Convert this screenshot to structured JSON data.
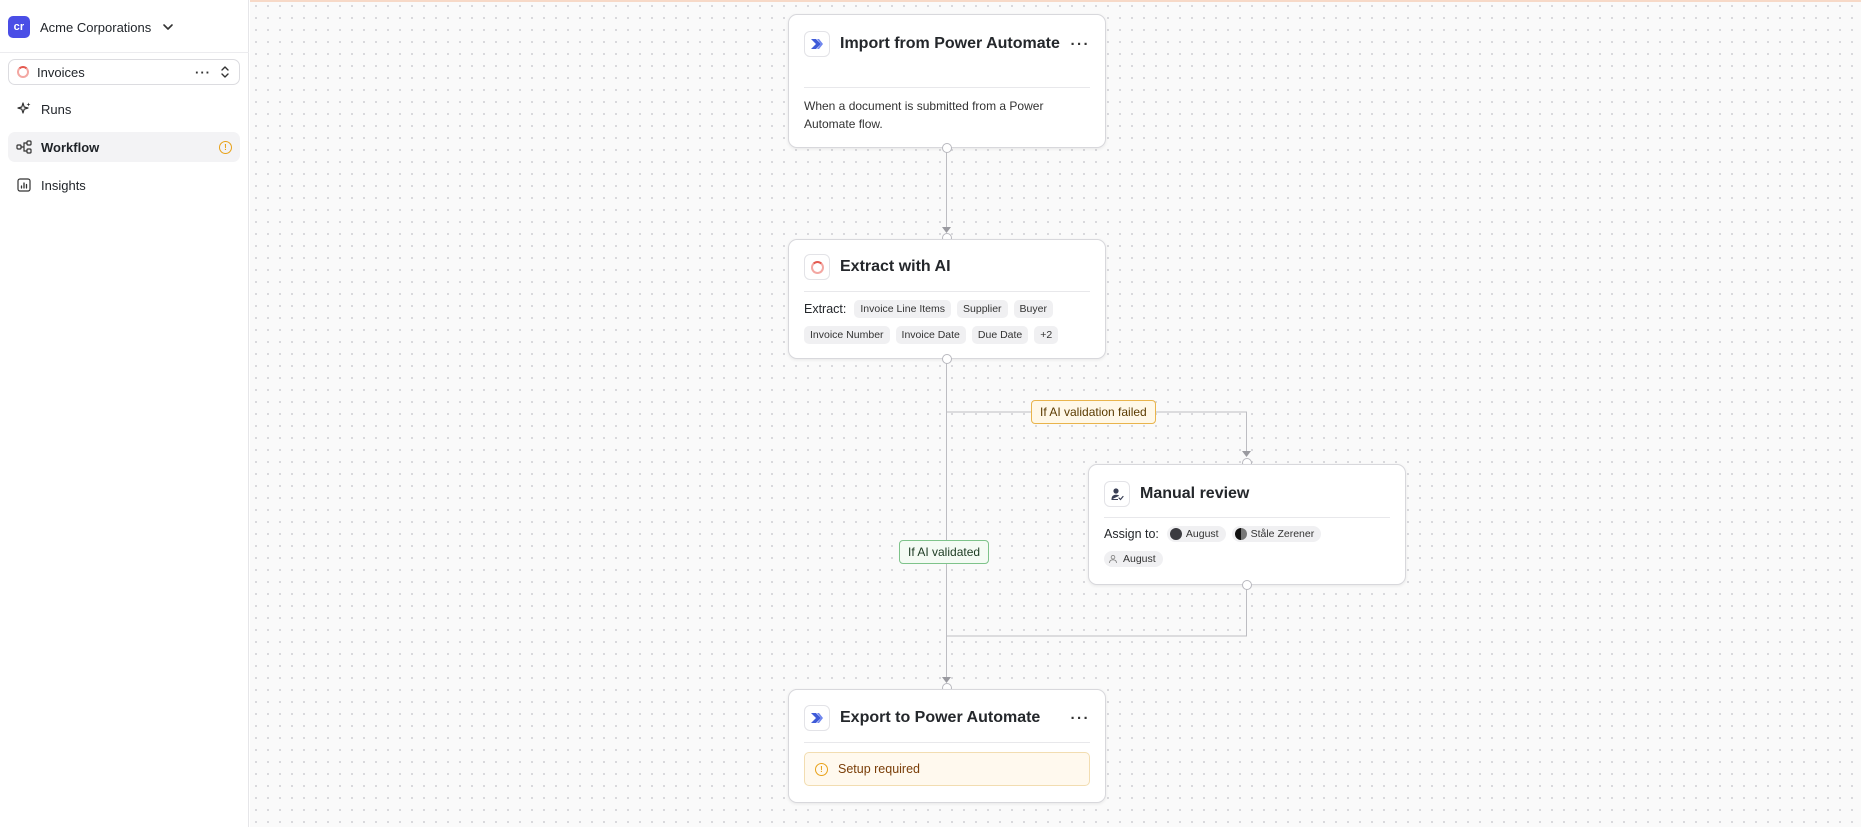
{
  "sidebar": {
    "org": {
      "initials": "cr",
      "name": "Acme Corporations",
      "badge_color": "#4a4ee6"
    },
    "project": {
      "name": "Invoices"
    },
    "nav": [
      {
        "label": "Runs",
        "icon": "sparkle-icon"
      },
      {
        "label": "Workflow",
        "icon": "workflow-icon",
        "active": true,
        "warning": true
      },
      {
        "label": "Insights",
        "icon": "chart-icon"
      }
    ]
  },
  "workflow": {
    "nodes": {
      "import": {
        "title": "Import from Power Automate",
        "description": "When a document is submitted from a Power Automate flow.",
        "icon": "power-automate-icon"
      },
      "extract": {
        "title": "Extract with AI",
        "label": "Extract:",
        "fields": [
          "Invoice Line Items",
          "Supplier",
          "Buyer",
          "Invoice Number",
          "Invoice Date",
          "Due Date",
          "+2"
        ],
        "icon": "ai-ring-icon"
      },
      "review": {
        "title": "Manual review",
        "label": "Assign to:",
        "assignees": [
          "August",
          "Ståle Zerener",
          "August"
        ],
        "icon": "user-check-icon"
      },
      "export": {
        "title": "Export to Power Automate",
        "status": "Setup required",
        "icon": "power-automate-icon"
      }
    },
    "edge_labels": {
      "fail": "If AI validation failed",
      "ok": "If AI validated"
    },
    "colors": {
      "warning": "#e8a21a",
      "fail_border": "#e9b44c",
      "ok_border": "#7ec38a",
      "accent": "#4a4ee6"
    }
  }
}
